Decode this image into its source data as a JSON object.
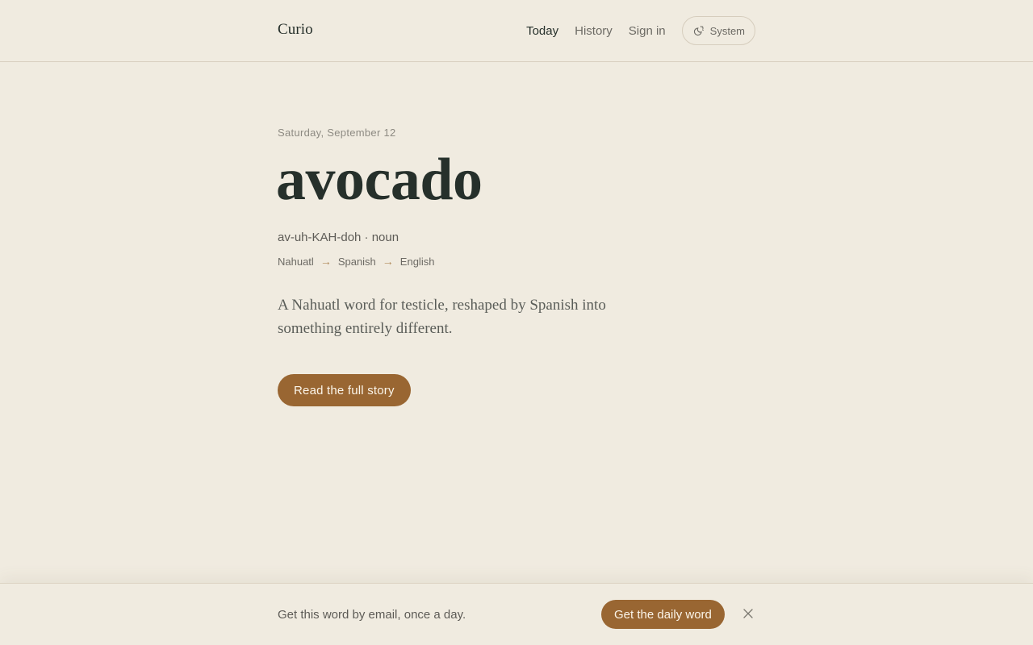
{
  "header": {
    "logo": "Curio",
    "nav": {
      "today": "Today",
      "history": "History",
      "sign_in": "Sign in"
    },
    "theme_toggle": {
      "label": "System",
      "icon": "sun-moon-icon"
    }
  },
  "entry": {
    "date": "Saturday, September 12",
    "word": "avocado",
    "pronunciation": "av-uh-KAH-doh · noun",
    "etymology": [
      "Nahuatl",
      "Spanish",
      "English"
    ],
    "etymology_arrow": "→",
    "blurb": "A Nahuatl word for testicle, reshaped by Spanish into something entirely different.",
    "cta_label": "Read the full story"
  },
  "banner": {
    "text": "Get this word by email, once a day.",
    "cta_label": "Get the daily word",
    "close_icon": "close-icon"
  },
  "colors": {
    "background": "#f0ebe0",
    "accent": "#996632",
    "text": "#26302b"
  }
}
